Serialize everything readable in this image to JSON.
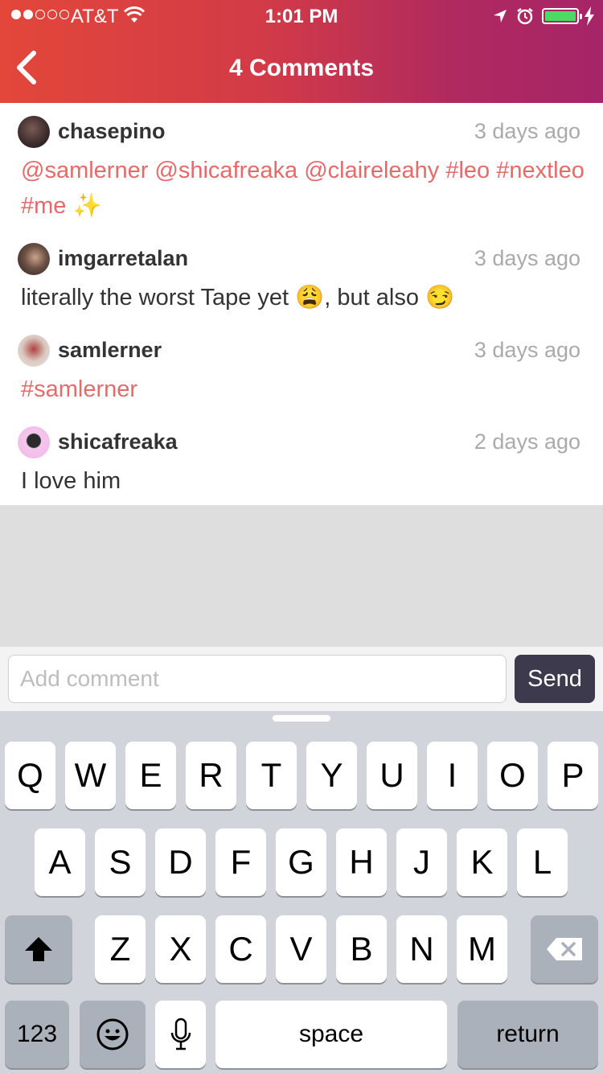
{
  "status_bar": {
    "carrier": "AT&T",
    "time": "1:01 PM",
    "signal_bars_filled": 2,
    "signal_bars_total": 5,
    "battery_level": 1.0
  },
  "header": {
    "title": "4 Comments",
    "back_icon": "chevron-left-icon",
    "gradient_colors": [
      "#e3473a",
      "#a62468"
    ]
  },
  "comments": [
    {
      "username": "chasepino",
      "time": "3 days ago",
      "text": "@samlerner @shicafreaka @claireleahy #leo #nextleo #me ✨"
    },
    {
      "username": "imgarretalan",
      "time": "3 days ago",
      "text": "literally the worst Tape yet 😩, but also 😏"
    },
    {
      "username": "samlerner",
      "time": "3 days ago",
      "text": "#samlerner"
    },
    {
      "username": "shicafreaka",
      "time": "2 days ago",
      "text": "I love him"
    }
  ],
  "composer": {
    "placeholder": "Add comment",
    "send_label": "Send"
  },
  "keyboard": {
    "row1": [
      "Q",
      "W",
      "E",
      "R",
      "T",
      "Y",
      "U",
      "I",
      "O",
      "P"
    ],
    "row2": [
      "A",
      "S",
      "D",
      "F",
      "G",
      "H",
      "J",
      "K",
      "L"
    ],
    "row3": [
      "Z",
      "X",
      "C",
      "V",
      "B",
      "N",
      "M"
    ],
    "numbers_label": "123",
    "space_label": "space",
    "return_label": "return"
  },
  "colors": {
    "tag": "#e66a6a",
    "send_button": "#3d3a4d",
    "time_gray": "#aaaaaa"
  }
}
